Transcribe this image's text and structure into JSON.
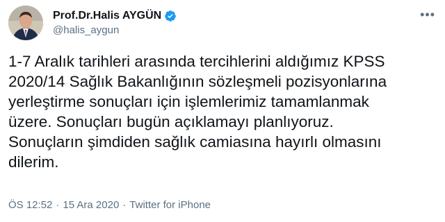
{
  "author": {
    "display_name": "Prof.Dr.Halis AYGÜN",
    "handle": "@halis_aygun",
    "verified_icon": "verified-badge-icon",
    "verified_color": "#1d9bf0"
  },
  "tweet": {
    "text": "1-7 Aralık tarihleri arasında tercihlerini aldığımız KPSS\n2020/14 Sağlık Bakanlığının sözleşmeli pozisyonlarına\nyerleştirme sonuçları için işlemlerimiz tamamlanmak\nüzere. Sonuçları bugün açıklamayı planlıyoruz.\nSonuçların şimdiden sağlık camiasına hayırlı olmasını\ndilerim.",
    "time": "ÖS 12:52",
    "separator": "·",
    "date": "15 Ara 2020",
    "source": "Twitter for iPhone"
  },
  "menu": {
    "icon": "more-options-icon",
    "glyph": "•••"
  }
}
